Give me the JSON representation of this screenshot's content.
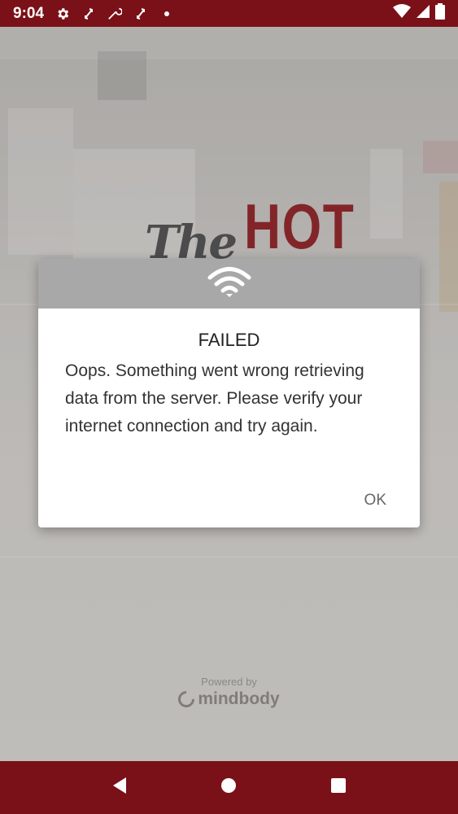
{
  "status_bar": {
    "time": "9:04",
    "icons": [
      "settings-icon",
      "sync-icon",
      "wrench-icon",
      "sync-icon",
      "dot-icon",
      "wifi-icon",
      "signal-icon",
      "battery-icon"
    ]
  },
  "logo": {
    "the": "The",
    "hot": "HOT"
  },
  "dialog": {
    "header_icon": "wifi-icon",
    "title": "FAILED",
    "message": "Oops. Something went wrong retrieving data from the server. Please verify your internet connection and try again.",
    "ok_label": "OK"
  },
  "footer": {
    "powered_by": "Powered by",
    "brand": "mindbody"
  },
  "nav_bar": {
    "icons": [
      "back-icon",
      "home-icon",
      "recents-icon"
    ]
  },
  "colors": {
    "brand": "#7a1118",
    "logo_red": "#8b1a1f"
  }
}
